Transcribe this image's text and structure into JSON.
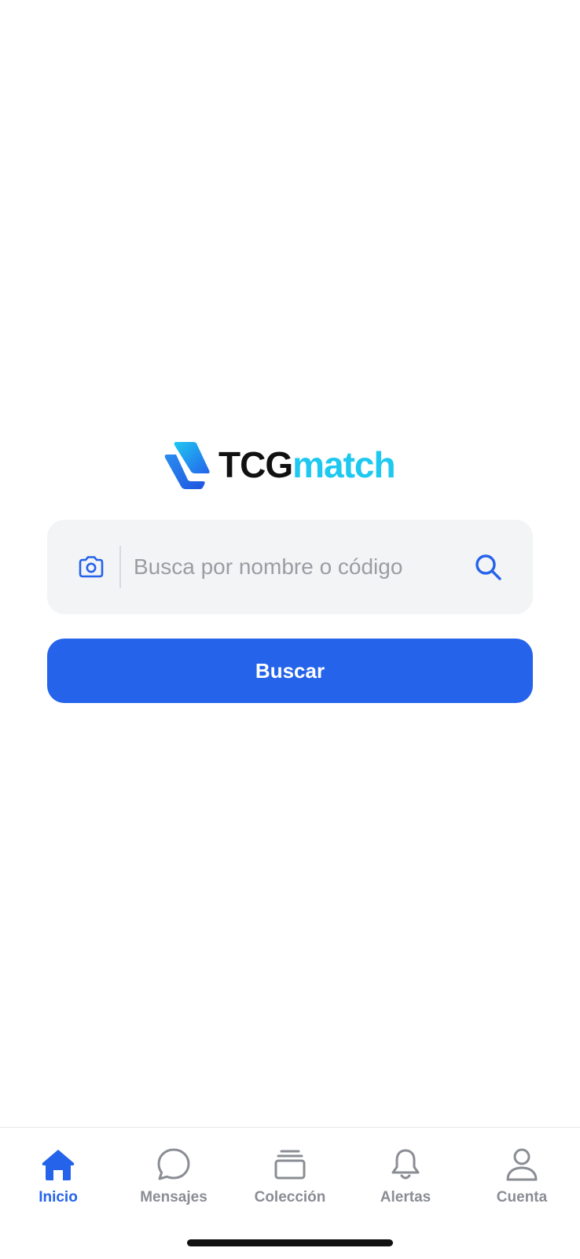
{
  "brand": {
    "name_part1": "TCG",
    "name_part2": "match",
    "logo_icon": "stacked-cards-logo-icon",
    "colors": {
      "dark": "#111111",
      "accent": "#1ec8f0",
      "primary": "#2563eb"
    }
  },
  "search": {
    "placeholder": "Busca por nombre o código",
    "camera_icon": "camera-icon",
    "search_icon": "search-icon"
  },
  "primary_button": {
    "label": "Buscar"
  },
  "tabbar": {
    "items": [
      {
        "label": "Inicio",
        "icon": "home-icon",
        "active": true
      },
      {
        "label": "Mensajes",
        "icon": "chat-bubble-icon",
        "active": false
      },
      {
        "label": "Colección",
        "icon": "cards-stack-icon",
        "active": false
      },
      {
        "label": "Alertas",
        "icon": "bell-icon",
        "active": false
      },
      {
        "label": "Cuenta",
        "icon": "user-icon",
        "active": false
      }
    ],
    "active_color": "#2563eb",
    "inactive_color": "#8a8d93"
  }
}
